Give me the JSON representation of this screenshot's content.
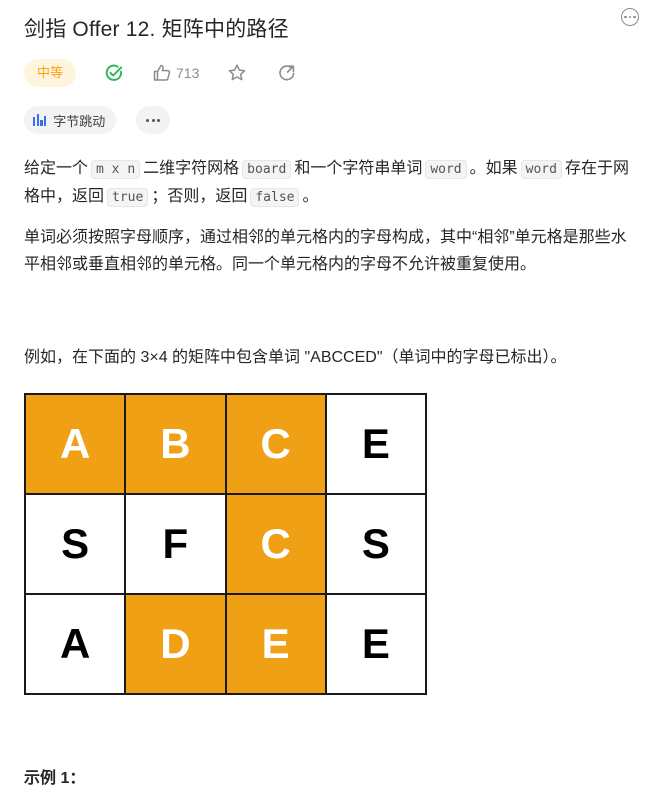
{
  "problem": {
    "title": "剑指 Offer 12. 矩阵中的路径",
    "difficulty": "中等",
    "likes": "713",
    "company_tag": "字节跳动"
  },
  "description": {
    "p1": {
      "t1": "给定一个",
      "c1": "m x n",
      "t2": "二维字符网格",
      "c2": "board",
      "t3": "和一个字符串单词",
      "c3": "word",
      "t4": "。如果",
      "c4": "word",
      "t5": "存在于网格中，返回",
      "c5": "true",
      "t6": "；否则，返回",
      "c6": "false",
      "t7": "。"
    },
    "p2": "单词必须按照字母顺序，通过相邻的单元格内的字母构成，其中“相邻”单元格是那些水平相邻或垂直相邻的单元格。同一个单元格内的字母不允许被重复使用。",
    "p3": "例如，在下面的 3×4 的矩阵中包含单词 \"ABCCED\"（单词中的字母已标出）。"
  },
  "grid": {
    "rows": [
      [
        "A",
        "B",
        "C",
        "E"
      ],
      [
        "S",
        "F",
        "C",
        "S"
      ],
      [
        "A",
        "D",
        "E",
        "E"
      ]
    ],
    "highlighted": [
      [
        0,
        0
      ],
      [
        0,
        1
      ],
      [
        0,
        2
      ],
      [
        1,
        2
      ],
      [
        2,
        2
      ],
      [
        2,
        1
      ]
    ],
    "highlight_color": "#f0a014"
  },
  "example": {
    "title": "示例 1："
  },
  "colors": {
    "difficulty_text": "#ffa116",
    "difficulty_bg": "#fff4dc",
    "accepted_green": "#2db55d",
    "company_icon": "#3b6cf5"
  },
  "icons": {
    "header_more": "more-horizontal-circle-icon",
    "accepted": "check-circle-icon",
    "like": "thumbs-up-icon",
    "favorite": "star-icon",
    "share": "share-icon",
    "tag_more": "more-horizontal-icon"
  }
}
